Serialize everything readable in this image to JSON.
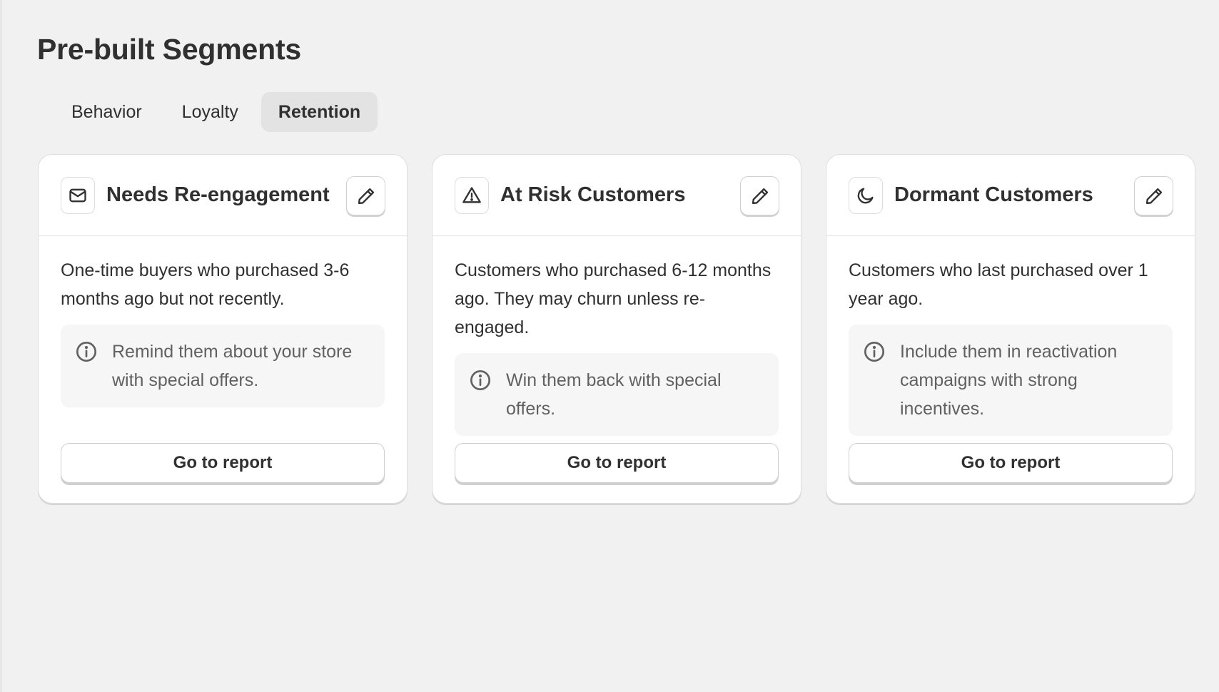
{
  "page": {
    "title": "Pre-built Segments"
  },
  "tabs": [
    {
      "label": "Behavior",
      "active": false
    },
    {
      "label": "Loyalty",
      "active": false
    },
    {
      "label": "Retention",
      "active": true
    }
  ],
  "cards": [
    {
      "icon": "envelope-icon",
      "title": "Needs Re-engagement",
      "description": "One-time buyers who purchased 3-6 months ago but not recently.",
      "tip": "Remind them about your store with special offers.",
      "button_label": "Go to report"
    },
    {
      "icon": "warning-icon",
      "title": "At Risk Customers",
      "description": "Customers who purchased 6-12 months ago. They may churn unless re-engaged.",
      "tip": "Win them back with special offers.",
      "button_label": "Go to report"
    },
    {
      "icon": "moon-icon",
      "title": "Dormant Customers",
      "description": "Customers who last purchased over 1 year ago.",
      "tip": "Include them in reactivation campaigns with strong incentives.",
      "button_label": "Go to report"
    }
  ],
  "colors": {
    "background": "#f1f1f1",
    "card": "#ffffff",
    "active_tab": "#e3e3e3",
    "text": "#303030",
    "muted_text": "#616161"
  }
}
